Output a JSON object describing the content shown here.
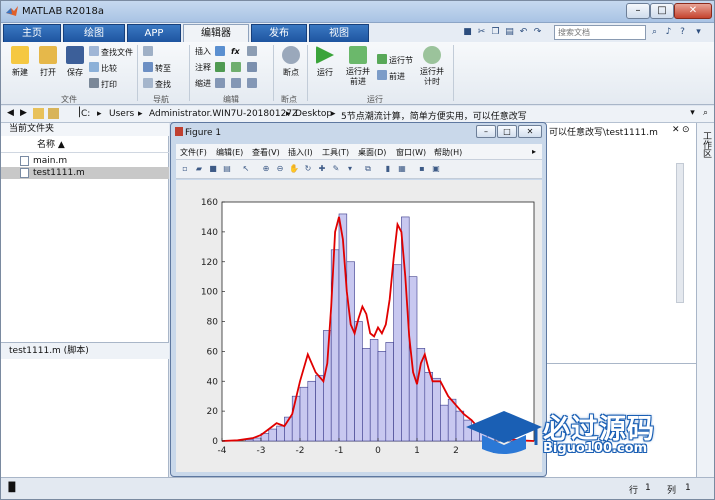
{
  "window": {
    "title": "MATLAB R2018a",
    "min": "–",
    "max": "□",
    "close": "✕"
  },
  "tabs": [
    "主页",
    "绘图",
    "APP",
    "编辑器",
    "发布",
    "视图"
  ],
  "active_tab": "编辑器",
  "search": {
    "placeholder": "搜索文档"
  },
  "ribbon": {
    "file": {
      "new": "新建",
      "open": "打开",
      "save": "保存",
      "find_files": "查找文件",
      "compare": "比较",
      "print": "打印",
      "group": "文件"
    },
    "navigate": {
      "go_to": "转至",
      "find": "查找",
      "group": "导航"
    },
    "edit": {
      "insert": "插入",
      "comment": "注释",
      "indent": "缩进",
      "fx": "fx",
      "group": "编辑"
    },
    "breakpoints": {
      "label": "断点",
      "group": "断点"
    },
    "run": {
      "run": "运行",
      "run_advance": "运行并前进",
      "run_section": "运行节",
      "advance": "前进",
      "run_time": "运行并计时",
      "group": "运行"
    }
  },
  "address": {
    "segments": [
      "C:",
      "Users",
      "Administrator.WIN7U-20180127Z",
      "Desktop",
      "5节点潮流计算，简单方便实用，可以任意改写"
    ]
  },
  "left_panel": {
    "header": "当前文件夹",
    "column": "名称 ▲",
    "files": [
      "main.m",
      "test1111.m"
    ],
    "details": "test1111.m  (脚本)"
  },
  "editor_header": "可以任意改写\\test1111.m",
  "workspace": "工作区",
  "figure": {
    "title": "Figure 1",
    "menu": [
      "文件(F)",
      "编辑(E)",
      "查看(V)",
      "插入(I)",
      "工具(T)",
      "桌面(D)",
      "窗口(W)",
      "帮助(H)"
    ]
  },
  "status": {
    "row_label": "行",
    "row": "1",
    "col_label": "列",
    "col": "1"
  },
  "watermark": {
    "cn": "必过源码",
    "en": "Biguo100.com"
  },
  "colors": {
    "bar_fill": "#c8c8f0",
    "bar_edge": "#3a3a8a",
    "curve": "#e00000",
    "tab_blue": "#2a64ae"
  },
  "chart_data": {
    "type": "bar",
    "xlim": [
      -4,
      4
    ],
    "ylim": [
      0,
      160
    ],
    "xticks": [
      -4,
      -3,
      -2,
      -1,
      0,
      1,
      2,
      3
    ],
    "yticks": [
      0,
      20,
      40,
      60,
      80,
      100,
      120,
      140,
      160
    ],
    "bin_width": 0.2,
    "bin_centers": [
      -3.9,
      -3.7,
      -3.5,
      -3.3,
      -3.1,
      -2.9,
      -2.7,
      -2.5,
      -2.3,
      -2.1,
      -1.9,
      -1.7,
      -1.5,
      -1.3,
      -1.1,
      -0.9,
      -0.7,
      -0.5,
      -0.3,
      -0.1,
      0.1,
      0.3,
      0.5,
      0.7,
      0.9,
      1.1,
      1.3,
      1.5,
      1.7,
      1.9,
      2.1,
      2.3,
      2.5,
      2.7,
      2.9,
      3.1,
      3.3,
      3.5,
      3.7,
      3.9
    ],
    "counts": [
      0,
      0,
      0,
      1,
      2,
      5,
      8,
      10,
      16,
      30,
      36,
      40,
      44,
      74,
      128,
      152,
      120,
      80,
      62,
      68,
      60,
      66,
      118,
      150,
      110,
      62,
      46,
      42,
      24,
      28,
      20,
      14,
      10,
      6,
      4,
      2,
      1,
      1,
      0,
      0
    ],
    "curve": {
      "x": [
        -4,
        -3.6,
        -3.2,
        -3.0,
        -2.8,
        -2.6,
        -2.4,
        -2.2,
        -2.0,
        -1.8,
        -1.6,
        -1.4,
        -1.3,
        -1.2,
        -1.1,
        -1.0,
        -0.9,
        -0.8,
        -0.7,
        -0.6,
        -0.5,
        -0.4,
        -0.3,
        -0.2,
        -0.1,
        0,
        0.1,
        0.2,
        0.3,
        0.4,
        0.5,
        0.6,
        0.7,
        0.8,
        0.9,
        1.0,
        1.1,
        1.2,
        1.3,
        1.4,
        1.6,
        1.8,
        2.0,
        2.2,
        2.4,
        2.6,
        2.8,
        3.0,
        3.2,
        3.6,
        4
      ],
      "y": [
        0,
        0.5,
        2,
        4,
        8,
        12,
        10,
        18,
        40,
        58,
        46,
        40,
        52,
        90,
        140,
        150,
        135,
        100,
        78,
        72,
        82,
        90,
        85,
        72,
        70,
        76,
        72,
        78,
        95,
        122,
        145,
        140,
        110,
        70,
        46,
        38,
        52,
        58,
        48,
        40,
        40,
        30,
        24,
        18,
        14,
        8,
        5,
        3,
        2,
        0.5,
        0
      ]
    }
  }
}
